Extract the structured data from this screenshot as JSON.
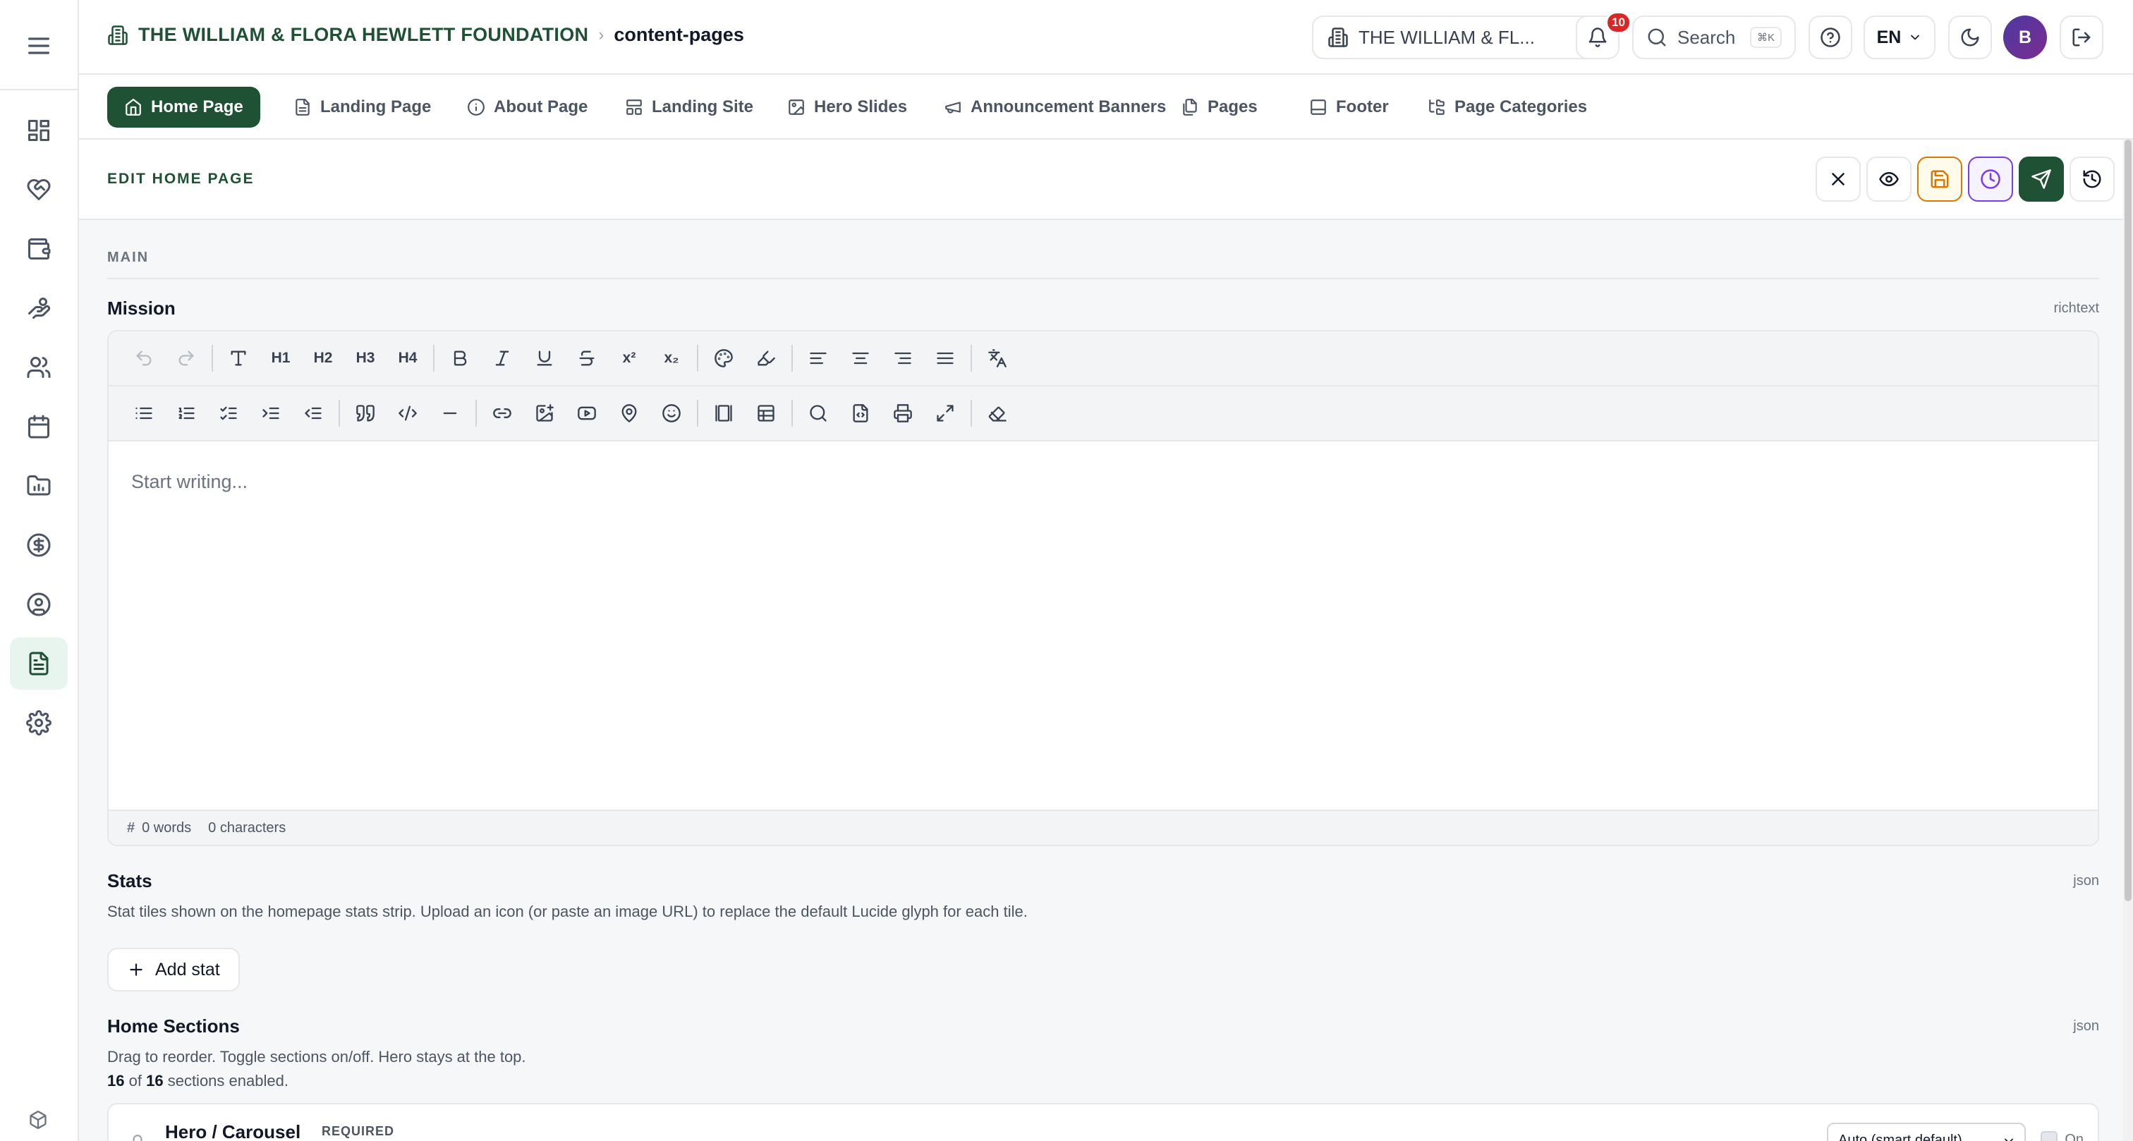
{
  "header": {
    "org_name": "THE WILLIAM & FLORA HEWLETT FOUNDATION",
    "breadcrumb_separator": "›",
    "current_page": "content-pages",
    "org_selector": "THE WILLIAM & FL...",
    "notification_count": "10",
    "search_placeholder": "Search",
    "search_shortcut": "⌘K",
    "language": "EN",
    "avatar_initial": "B"
  },
  "tabs": [
    {
      "label": "Home Page",
      "icon": "home-icon",
      "active": true
    },
    {
      "label": "Landing Page",
      "icon": "file-text-icon"
    },
    {
      "label": "About Page",
      "icon": "info-icon"
    },
    {
      "label": "Landing Site",
      "icon": "layout-icon"
    },
    {
      "label": "Hero Slides",
      "icon": "image-icon"
    },
    {
      "label": "Announcement Banners",
      "icon": "megaphone-icon"
    },
    {
      "label": "Pages",
      "icon": "files-icon"
    },
    {
      "label": "Footer",
      "icon": "panel-bottom-icon"
    },
    {
      "label": "Page Categories",
      "icon": "folder-tree-icon"
    }
  ],
  "sidebar": {
    "items": [
      {
        "icon": "dashboard-icon"
      },
      {
        "icon": "heart-handshake-icon"
      },
      {
        "icon": "wallet-icon"
      },
      {
        "icon": "hand-coins-icon"
      },
      {
        "icon": "users-icon"
      },
      {
        "icon": "calendar-icon"
      },
      {
        "icon": "chart-folder-icon"
      },
      {
        "icon": "dollar-icon"
      },
      {
        "icon": "user-circle-icon"
      },
      {
        "icon": "document-icon",
        "active": true
      },
      {
        "icon": "settings-icon"
      }
    ]
  },
  "edit": {
    "title": "EDIT HOME PAGE",
    "section": "MAIN"
  },
  "mission": {
    "label": "Mission",
    "type": "richtext",
    "placeholder": "Start writing...",
    "words": "0 words",
    "characters": "0 characters",
    "toolbar_text": {
      "h1": "H1",
      "h2": "H2",
      "h3": "H3",
      "h4": "H4",
      "sup": "x²",
      "sub": "x₂"
    }
  },
  "stats": {
    "label": "Stats",
    "type": "json",
    "help": "Stat tiles shown on the homepage stats strip. Upload an icon (or paste an image URL) to replace the default Lucide glyph for each tile.",
    "add_label": "Add stat"
  },
  "home_sections": {
    "label": "Home Sections",
    "type": "json",
    "help": "Drag to reorder. Toggle sections on/off. Hero stays at the top.",
    "enabled_count": "16",
    "of": "of",
    "total_count": "16",
    "enabled_suffix": "sections enabled.",
    "first_section": {
      "name": "Hero / Carousel",
      "badge": "REQUIRED",
      "mode": "Auto (smart default)",
      "toggle": "On"
    }
  },
  "colors": {
    "brand": "#1f5135",
    "save": "#d97706",
    "schedule": "#7c3aed",
    "badge": "#dc2626"
  }
}
